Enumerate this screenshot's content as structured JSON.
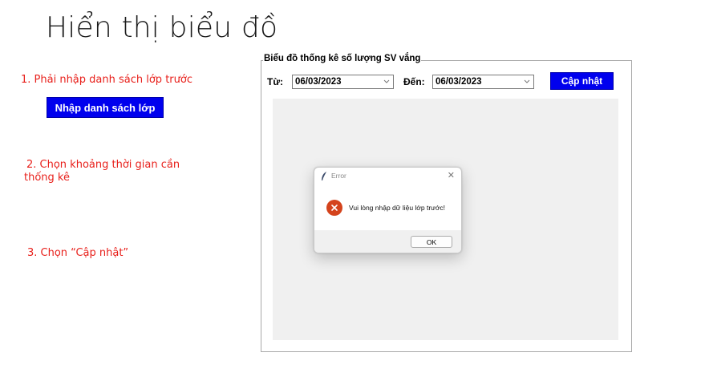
{
  "slide": {
    "title": "Hiển thị biểu đồ",
    "step1": "1. Phải nhập danh sách lớp trước",
    "import_button": "Nhập danh sách lớp",
    "step2_line1": "2. Chọn khoảng thời gian cần",
    "step2_line2": "thống kê",
    "step3": "3. Chọn “Cập nhật”"
  },
  "app": {
    "group_title": "Biểu đồ thống kê số lượng SV vắng",
    "from_label": "Từ:",
    "from_date": "06/03/2023",
    "to_label": "Đến:",
    "to_date": "06/03/2023",
    "update_button": "Cập nhật"
  },
  "dialog": {
    "title": "Error",
    "message": "Vui lòng nhập dữ liệu lớp trước!",
    "ok_button": "OK"
  },
  "colors": {
    "step_text": "#e8201b",
    "button_blue": "#0000ee",
    "error_icon": "#d4431c",
    "chart_bg": "#f0f0f0"
  },
  "icons": {
    "dropdown": "chevron-down-icon",
    "dialog_app": "feather-icon",
    "dialog_close": "close-icon",
    "dialog_error": "error-icon"
  }
}
